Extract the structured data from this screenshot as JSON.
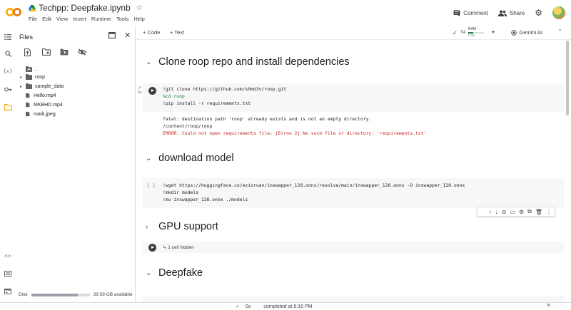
{
  "header": {
    "notebook_title": "Techpp: Deepfake.ipynb",
    "menu": [
      "File",
      "Edit",
      "View",
      "Insert",
      "Runtime",
      "Tools",
      "Help"
    ],
    "comment_label": "Comment",
    "share_label": "Share"
  },
  "toolbar": {
    "add_code_label": "+ Code",
    "add_text_label": "+ Text",
    "runtime_badge": "T4",
    "ram_label": "RAM",
    "disk_label": "Disk",
    "gemini_label": "Gemini AI"
  },
  "files": {
    "title": "Files",
    "items": [
      {
        "name": "..",
        "type": "folder-up",
        "caret": ""
      },
      {
        "name": "roop",
        "type": "folder",
        "caret": "▸"
      },
      {
        "name": "sample_data",
        "type": "folder",
        "caret": "▸"
      },
      {
        "name": "Hello.mp4",
        "type": "file",
        "caret": ""
      },
      {
        "name": "MKBHD.mp4",
        "type": "file",
        "caret": ""
      },
      {
        "name": "mark.jpeg",
        "type": "file",
        "caret": ""
      }
    ],
    "disk_label": "Disk",
    "disk_available": "39.59 GB available",
    "disk_used_fraction": 0.8
  },
  "sections": [
    {
      "title": "Clone roop repo and install dependencies",
      "expanded": true
    },
    {
      "title": "download model",
      "expanded": true
    },
    {
      "title": "GPU support",
      "expanded": false
    },
    {
      "title": "Deepfake",
      "expanded": true
    }
  ],
  "cells": {
    "clone": {
      "lines": [
        "!git clone https://github.com/s0md3v/roop.git",
        "%cd roop",
        "!pip install -r requirements.txt"
      ],
      "output": [
        "fatal: destination path 'roop' already exists and is not an empty directory.",
        "/content/roop/roop",
        "ERROR: Could not open requirements file: [Errno 2] No such file or directory: 'requirements.txt'"
      ],
      "exec_count": "5s"
    },
    "download": {
      "prompt": "[ ]",
      "lines": [
        "!wget https://huggingface.co/ezioruan/inswapper_128.onnx/resolve/main/inswapper_128.onnx -O inswapper_128.onnx",
        "!mkdir models",
        "!mv inswapper_128.onnx ./models"
      ]
    },
    "gpu": {
      "hidden_label": "↳ 1 cell hidden"
    }
  },
  "status": {
    "elapsed": "0s",
    "completed": "completed at 6:16 PM"
  },
  "colors": {
    "accent_orange": "#f9ab00",
    "success_green": "#188038",
    "error_red": "#c5221f"
  }
}
